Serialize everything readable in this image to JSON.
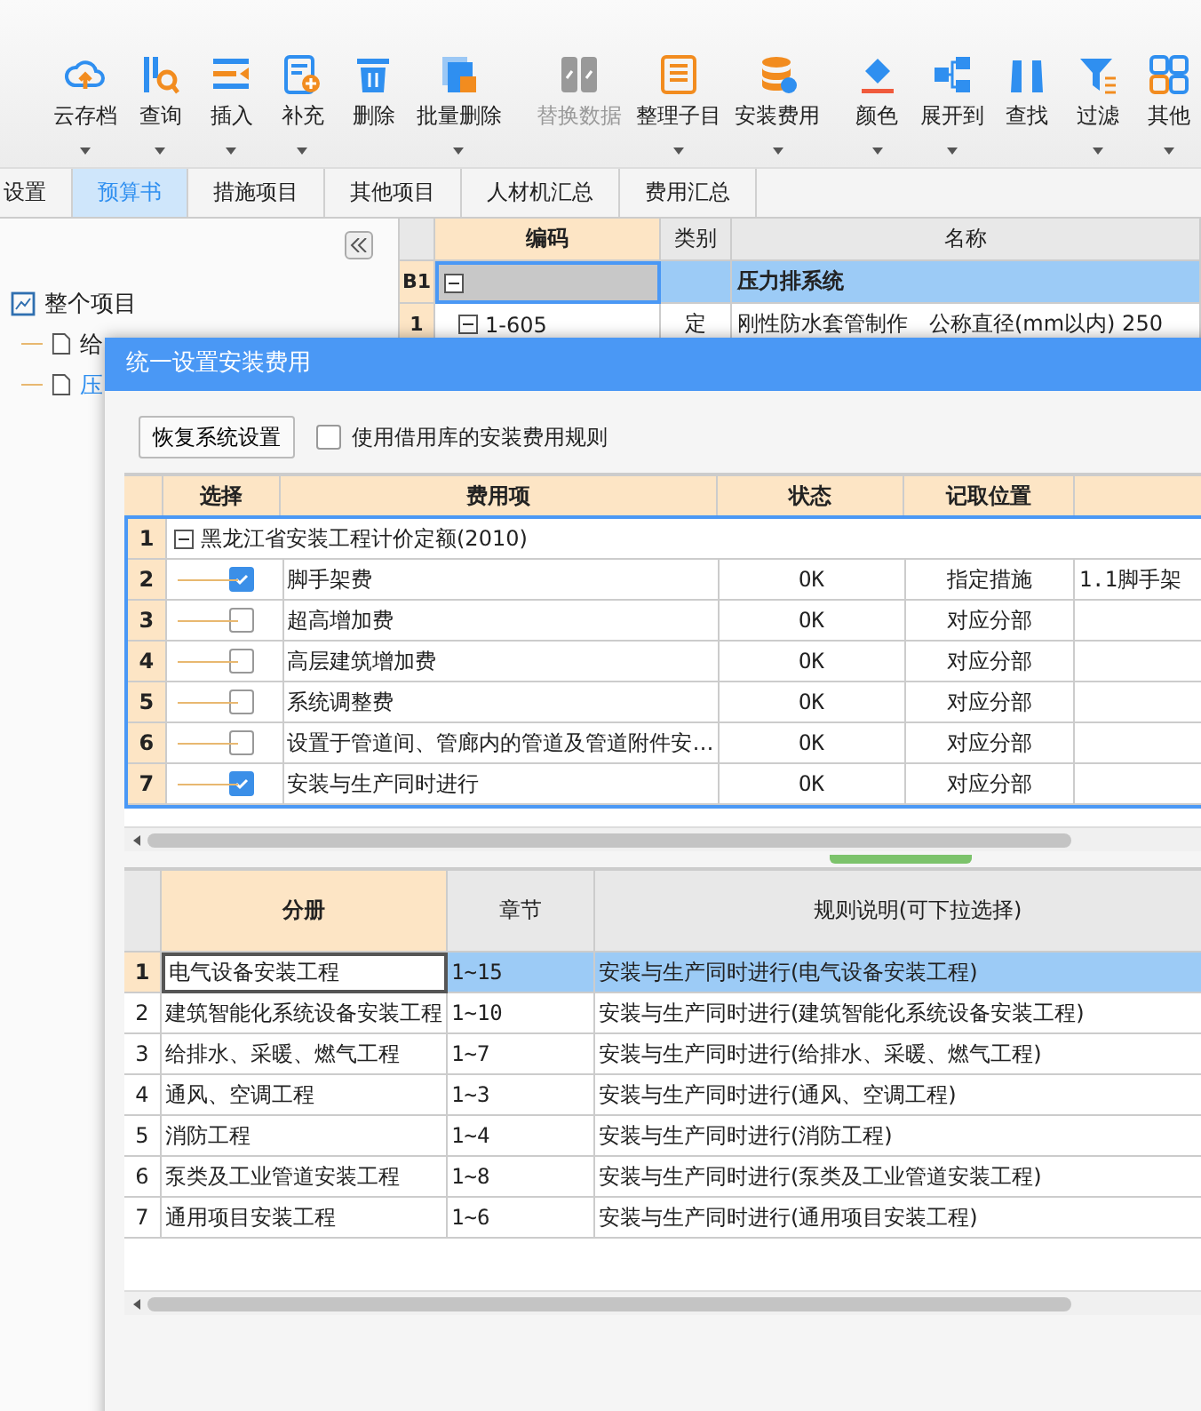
{
  "toolbar": {
    "items": [
      {
        "label": "云存档",
        "dropdown": true,
        "disabled": false
      },
      {
        "label": "查询",
        "dropdown": true,
        "disabled": false
      },
      {
        "label": "插入",
        "dropdown": true,
        "disabled": false
      },
      {
        "label": "补充",
        "dropdown": true,
        "disabled": false
      },
      {
        "label": "删除",
        "dropdown": false,
        "disabled": false
      },
      {
        "label": "批量删除",
        "dropdown": true,
        "disabled": false
      },
      {
        "label": "替换数据",
        "dropdown": false,
        "disabled": true
      },
      {
        "label": "整理子目",
        "dropdown": true,
        "disabled": false
      },
      {
        "label": "安装费用",
        "dropdown": true,
        "disabled": false
      },
      {
        "label": "颜色",
        "dropdown": true,
        "disabled": false
      },
      {
        "label": "展开到",
        "dropdown": true,
        "disabled": false
      },
      {
        "label": "查找",
        "dropdown": false,
        "disabled": false
      },
      {
        "label": "过滤",
        "dropdown": true,
        "disabled": false
      },
      {
        "label": "其他",
        "dropdown": true,
        "disabled": false
      }
    ]
  },
  "tabs": [
    {
      "label": "设置",
      "selected": false
    },
    {
      "label": "预算书",
      "selected": true
    },
    {
      "label": "措施项目",
      "selected": false
    },
    {
      "label": "其他项目",
      "selected": false
    },
    {
      "label": "人材机汇总",
      "selected": false
    },
    {
      "label": "费用汇总",
      "selected": false
    }
  ],
  "sidebar": {
    "tree": {
      "label": "整个项目",
      "children": [
        {
          "label": "给",
          "selected": false
        },
        {
          "label": "压",
          "selected": true
        }
      ]
    }
  },
  "grid": {
    "columns": [
      "编码",
      "类别",
      "名称"
    ],
    "rows": [
      {
        "kind": "group",
        "num": "B1",
        "code": "",
        "type": "",
        "name": "压力排系统",
        "selected": true
      },
      {
        "kind": "item",
        "num": "1",
        "code": "1-605",
        "type": "定",
        "name": "刚性防水套管制作　公称直径(mm以内) 250",
        "selected": false
      }
    ]
  },
  "dialog": {
    "title": "统一设置安装费用",
    "restore_button": "恢复系统设置",
    "borrow_rule": {
      "label": "使用借用库的安装费用规则",
      "checked": false
    },
    "fee_table": {
      "columns": [
        "选择",
        "费用项",
        "状态",
        "记取位置"
      ],
      "rows": [
        {
          "num": "1",
          "label": "黑龙江省安装工程计价定额(2010)",
          "expanded": true,
          "children": [
            {
              "num": "2",
              "checked": true,
              "name": "脚手架费",
              "status": "OK",
              "position": "指定措施",
              "column_5": "1.1脚手架"
            },
            {
              "num": "3",
              "checked": false,
              "name": "超高增加费",
              "status": "OK",
              "position": "对应分部"
            },
            {
              "num": "4",
              "checked": false,
              "name": "高层建筑增加费",
              "status": "OK",
              "position": "对应分部"
            },
            {
              "num": "5",
              "checked": false,
              "name": "系统调整费",
              "status": "OK",
              "position": "对应分部"
            },
            {
              "num": "6",
              "checked": false,
              "name": "设置于管道间、管廊内的管道及管道附件安…",
              "status": "OK",
              "position": "对应分部"
            },
            {
              "num": "7",
              "checked": true,
              "name": "安装与生产同时进行",
              "status": "OK",
              "position": "对应分部"
            }
          ]
        }
      ]
    },
    "rule_table": {
      "columns": [
        "分册",
        "章节",
        "规则说明(可下拉选择)"
      ],
      "rows": [
        {
          "num": "1",
          "volume": "电气设备安装工程",
          "chapters": "1~15",
          "rule": "安装与生产同时进行(电气设备安装工程)",
          "selected": true
        },
        {
          "num": "2",
          "volume": "建筑智能化系统设备安装工程",
          "chapters": "1~10",
          "rule": "安装与生产同时进行(建筑智能化系统设备安装工程)",
          "selected": false
        },
        {
          "num": "3",
          "volume": "给排水、采暖、燃气工程",
          "chapters": "1~7",
          "rule": "安装与生产同时进行(给排水、采暖、燃气工程)",
          "selected": false
        },
        {
          "num": "4",
          "volume": "通风、空调工程",
          "chapters": "1~3",
          "rule": "安装与生产同时进行(通风、空调工程)",
          "selected": false
        },
        {
          "num": "5",
          "volume": "消防工程",
          "chapters": "1~4",
          "rule": "安装与生产同时进行(消防工程)",
          "selected": false
        },
        {
          "num": "6",
          "volume": "泵类及工业管道安装工程",
          "chapters": "1~8",
          "rule": "安装与生产同时进行(泵类及工业管道安装工程)",
          "selected": false
        },
        {
          "num": "7",
          "volume": "通用项目安装工程",
          "chapters": "1~6",
          "rule": "安装与生产同时进行(通用项目安装工程)",
          "selected": false
        }
      ]
    }
  }
}
